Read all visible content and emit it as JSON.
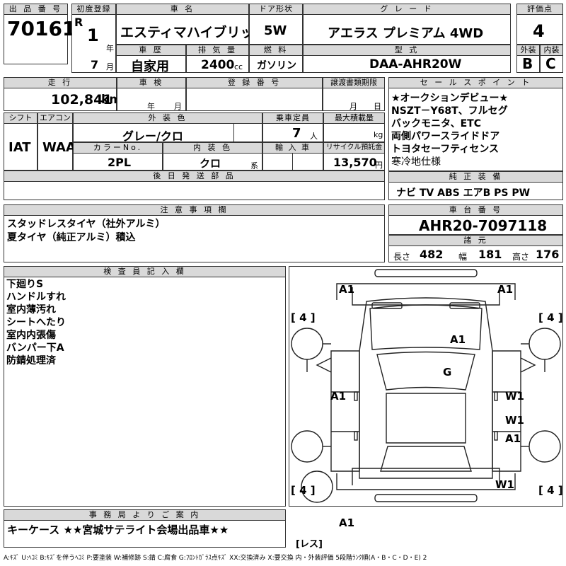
{
  "header": {
    "lot_label": "出 品 番 号",
    "lot": "70161",
    "first_reg_label": "初度登録",
    "era": "R",
    "year": "1",
    "year_unit": "年",
    "month": "7",
    "month_unit": "月",
    "name_label": "車 名",
    "name": "エスティマハイブリッド",
    "doors_label": "ドア形状",
    "doors": "5W",
    "grade_label": "グ レ ー ド",
    "grade": "アエラス プレミアム 4WD",
    "score_label": "評価点",
    "score": "4",
    "history_label": "車 歴",
    "history": "自家用",
    "displacement_label": "排 気 量",
    "displacement": "2400",
    "displacement_unit": "cc",
    "fuel_label": "燃 料",
    "fuel": "ガソリン",
    "model_label": "型 式",
    "model": "DAA-AHR20W",
    "ext_label": "外装",
    "ext": "B",
    "int_label": "内装",
    "int": "C"
  },
  "row2": {
    "mileage_label": "走 行",
    "mileage": "102,841",
    "mileage_unit": "km",
    "inspection_label": "車 検",
    "insp_year_unit": "年",
    "insp_month_unit": "月",
    "reg_label": "登 録 番 号",
    "transfer_label": "譲渡書類期限",
    "transfer_month_unit": "月",
    "transfer_day_unit": "日"
  },
  "row3": {
    "shift_label": "シフト",
    "shift": "IAT",
    "ac_label": "エアコン",
    "ac": "WAA",
    "color_label": "外 装 色",
    "color": "グレー/クロ",
    "capacity_label": "乗車定員",
    "capacity": "7",
    "capacity_unit": "人",
    "load_label": "最大積載量",
    "load_unit": "kg",
    "colorno_label": "カラーNo.",
    "colorno": "2PL",
    "intcolor_label": "内 装 色",
    "intcolor": "クロ",
    "intcolor_unit": "系",
    "import_label": "輸 入 車",
    "recycle_label": "リサイクル預託金",
    "recycle": "13,570",
    "recycle_unit": "円",
    "later_label": "後 日 発 送 部 品"
  },
  "sales": {
    "label": "セ ー ル ス ポ イ ン ト",
    "lines": [
      "★オークションデビュー★",
      "NSZT－Y68T、フルセグ",
      "バックモニタ、ETC",
      "両側パワースライドドア",
      "トヨタセーフティセンス",
      "寒冷地仕様"
    ]
  },
  "equipment": {
    "label": "純 正 装 備",
    "items": "ナビ TV ABS エアB PS PW"
  },
  "notes": {
    "label": "注 意 事 項 欄",
    "lines": [
      "スタッドレスタイヤ（社外アルミ）",
      "夏タイヤ（純正アルミ）積込"
    ]
  },
  "chassis": {
    "label": "車 台 番 号",
    "value": "AHR20-7097118"
  },
  "dims": {
    "label": "諸 元",
    "length_label": "長さ",
    "length": "482",
    "width_label": "幅",
    "width": "181",
    "height_label": "高さ",
    "height": "176"
  },
  "inspector": {
    "label": "検 査 員 記 入 欄",
    "lines": [
      "下廻りS",
      "ハンドルすれ",
      "室内薄汚れ",
      "シートへたり",
      "室内内張傷",
      "バンパー下A",
      "防錆処理済"
    ]
  },
  "diagram": {
    "marks": {
      "a1_front_left": "A1",
      "a1_front_right": "A1",
      "a1_hood": "A1",
      "g_windshield": "G",
      "a1_left": "A1",
      "w1_right1": "W1",
      "w1_right2": "W1",
      "a1_right": "A1",
      "w1_rear_right": "W1",
      "a1_rear": "A1"
    },
    "tires": {
      "fl": "[ 4 ]",
      "fr": "[ 4 ]",
      "rl": "[ 4 ]",
      "rr": "[ 4 ]",
      "spare": "[レス]"
    }
  },
  "office": {
    "label": "事 務 局 よ り ご 案 内",
    "text": "キーケース ★★宮城サテライト会場出品車★★"
  },
  "legend": "A:ｷｽﾞ U:ﾍｺﾐ B:ｷｽﾞを伴うﾍｺﾐ P:要塗装 W:補修跡 S:錆 C:腐食 G:ﾌﾛﾝﾄｶﾞﾗｽ点ｷｽﾞ XX:交換済み X:要交換 内・外装評価 5段階ﾗﾝｸ順(A・B・C・D・E) 2"
}
